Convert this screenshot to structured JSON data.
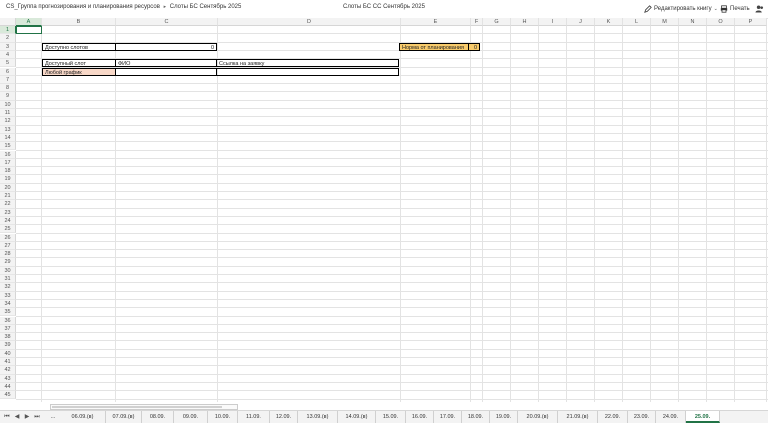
{
  "breadcrumb": {
    "path": "CS_Группа прогнозирования и планирования ресурсов",
    "separator": "▸",
    "file": "Слоты БС Сентябрь 2025"
  },
  "document_title": "Слоты БС СС Сентябрь 2025",
  "toolbar": {
    "edit_label": "Редактировать книгу",
    "print_label": "Печать"
  },
  "columns": [
    "A",
    "B",
    "C",
    "D",
    "E",
    "F",
    "G",
    "H",
    "I",
    "J",
    "K",
    "L",
    "M",
    "N",
    "O",
    "P"
  ],
  "rows": [
    "1",
    "2",
    "3",
    "4",
    "5",
    "6",
    "7",
    "8",
    "9",
    "10",
    "11",
    "12",
    "13",
    "14",
    "15",
    "16",
    "17",
    "18",
    "19",
    "20",
    "21",
    "22",
    "23",
    "24",
    "25",
    "26",
    "27",
    "28",
    "29",
    "30",
    "31",
    "32",
    "33",
    "34",
    "35",
    "36",
    "37",
    "38",
    "39",
    "40",
    "41",
    "42",
    "43",
    "44",
    "45"
  ],
  "sheet": {
    "b2": "Доступно слотов",
    "c2": "0",
    "e2": "Норма от планирования",
    "f2": "0",
    "b4": "Доступный слот",
    "c4": "ФИО",
    "d4": "Ссылка на заявку",
    "b5": "Любой график"
  },
  "colors": {
    "accent": "#217346",
    "norm_fill": "#f8cb6b",
    "any_schedule_fill": "#f8d8c8"
  },
  "sheet_tabs": {
    "nav": [
      "⏮",
      "◀",
      "▶",
      "⏭",
      "..."
    ],
    "tabs": [
      "06.09.(в)",
      "07.09.(в)",
      "08.09.",
      "09.09.",
      "10.09.",
      "11.09.",
      "12.09.",
      "13.09.(в)",
      "14.09.(в)",
      "15.09.",
      "16.09.",
      "17.09.",
      "18.09.",
      "19.09.",
      "20.09.(в)",
      "21.09.(в)",
      "22.09.",
      "23.09.",
      "24.09.",
      "25.09."
    ],
    "active": "25.09."
  }
}
